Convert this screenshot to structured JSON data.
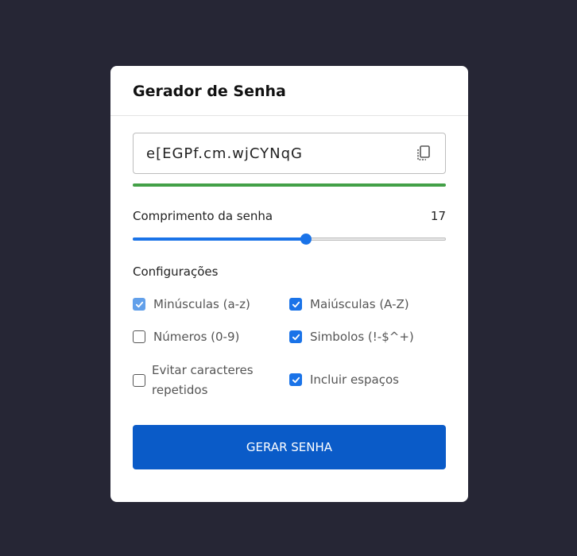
{
  "header": {
    "title": "Gerador de Senha"
  },
  "password": {
    "value": "e[EGPf.cm.wjCYNqG",
    "copy_icon": "copy-icon",
    "strength_fraction": 1.0,
    "strength_color": "#43a047"
  },
  "length": {
    "label": "Comprimento da senha",
    "value": "17",
    "slider_fraction": 0.553
  },
  "settings": {
    "title": "Configurações",
    "options": [
      {
        "label": "Minúsculas (a-z)",
        "checked": true,
        "disabled": true
      },
      {
        "label": "Maiúsculas (A-Z)",
        "checked": true,
        "disabled": false
      },
      {
        "label": "Números (0-9)",
        "checked": false,
        "disabled": false
      },
      {
        "label": "Simbolos (!-$^+)",
        "checked": true,
        "disabled": false
      },
      {
        "label": "Evitar caracteres repetidos",
        "checked": false,
        "disabled": false
      },
      {
        "label": "Incluir espaços",
        "checked": true,
        "disabled": false
      }
    ]
  },
  "generate_button": {
    "label": "GERAR SENHA"
  },
  "colors": {
    "background": "#262635",
    "accent": "#1a73e8",
    "button": "#0a5bc8",
    "strength": "#43a047"
  }
}
